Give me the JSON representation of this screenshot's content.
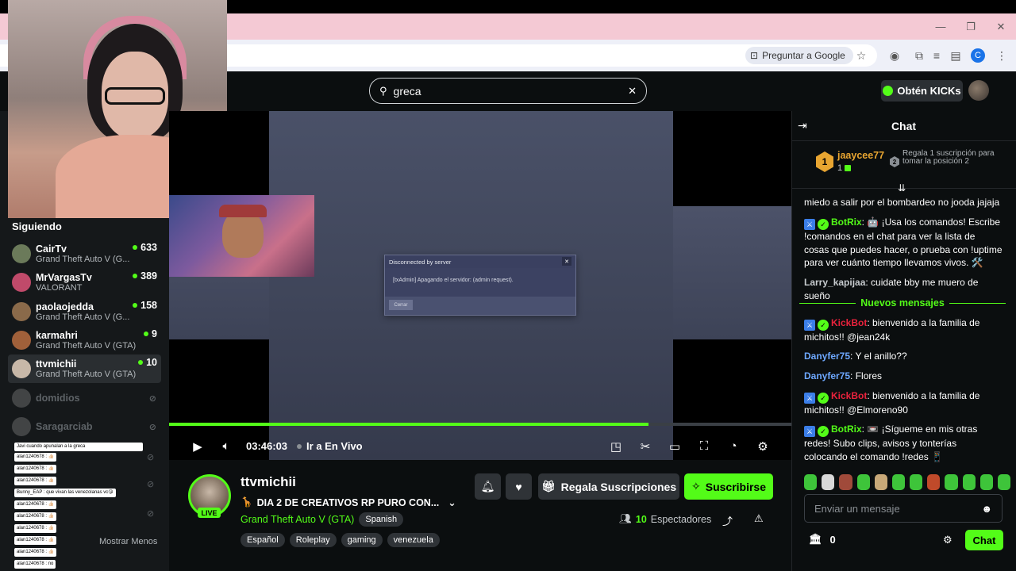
{
  "browser": {
    "google_button": "Preguntar a Google",
    "profile_initial": "C",
    "window_controls": [
      "—",
      "❐",
      "✕"
    ]
  },
  "header": {
    "search_value": "greca",
    "kicks_label": "Obtén KICKs"
  },
  "sidebar": {
    "following_title": "Siguiendo",
    "items": [
      {
        "name": "CairTv",
        "game": "Grand Theft Auto V (G...",
        "viewers": "633",
        "color": "#6b7a5a"
      },
      {
        "name": "MrVargasTv",
        "game": "VALORANT",
        "viewers": "389",
        "color": "#c04a6a"
      },
      {
        "name": "paolaojedda",
        "game": "Grand Theft Auto V (G...",
        "viewers": "158",
        "color": "#8a6a4a"
      },
      {
        "name": "karmahri",
        "game": "Grand Theft Auto V (GTA)",
        "viewers": "9",
        "color": "#a0603a"
      },
      {
        "name": "ttvmichii",
        "game": "Grand Theft Auto V (GTA)",
        "viewers": "10",
        "color": "#c8b8a8"
      }
    ],
    "offline": [
      {
        "name": "domidios"
      },
      {
        "name": "Saragarciab"
      }
    ],
    "show_less": "Mostrar Menos",
    "overlay_chat": [
      "Javi cuando apunalan a la greca",
      "alan1240678 : 👍🏻",
      "alan1240678 : 👍🏻",
      "alan1240678 : 👍🏻",
      "Bunny_EAP : que vivan las venezolanas vc😘",
      "alan1240678 : 👍🏻",
      "alan1240678 : 👍🏻",
      "alan1240678 : 👍🏻",
      "alan1240678 : 👍🏻",
      "alan1240678 : 👍🏻",
      "alan1240678 : no"
    ]
  },
  "video": {
    "dialog_title": "Disconnected by server",
    "dialog_message": "[txAdmin] Apagando el servidor: (admin request).",
    "dialog_button": "Cerrar",
    "time": "03:46:03",
    "go_live": "Ir a En Vivo",
    "progress": 0.77
  },
  "stream": {
    "name": "ttvmichii",
    "live_badge": "LIVE",
    "title": "DIA 2 DE CREATIVOS RP PURO CON...",
    "game": "Grand Theft Auto V (GTA)",
    "language_tag": "Spanish",
    "tags": [
      "Español",
      "Roleplay",
      "gaming",
      "venezuela"
    ],
    "gift_label": "Regala Suscripciones",
    "subscribe_label": "Suscribirse",
    "viewers_count": "10",
    "viewers_label": "Espectadores"
  },
  "chat": {
    "title": "Chat",
    "pinned_user": "jaaycee77",
    "pinned_count": "1",
    "pinned_rank": "1",
    "gift_rank": "2",
    "gift_text": "Regala 1 suscripción para tomar la posición 2",
    "messages_before": [
      {
        "user": "",
        "text": "miedo a salir por el bombardeo no jooda jajaja",
        "color": "#ffffff",
        "badges": false
      },
      {
        "user": "BotRix",
        "text": ": 🤖 ¡Usa los comandos! Escribe !comandos en el chat para ver la lista de cosas que puedes hacer, o prueba con !uptime para ver cuánto tiempo llevamos vivos. 🛠️",
        "color": "#53fc18",
        "badges": true
      },
      {
        "user": "Larry_kapijaa",
        "text": ": cuidate bby me muero de sueño",
        "color": "#c7cbce",
        "badges": false
      }
    ],
    "new_messages": "Nuevos mensajes",
    "messages_after": [
      {
        "user": "KickBot",
        "text": ": bienvenido a la familia de michitos!! @jean24k",
        "color": "#e8223c",
        "badges": true
      },
      {
        "user": "Danyfer75",
        "text": ": Y el anillo??",
        "color": "#6ea8ff",
        "badges": false
      },
      {
        "user": "Danyfer75",
        "text": ": Flores",
        "color": "#6ea8ff",
        "badges": false
      },
      {
        "user": "KickBot",
        "text": ": bienvenido a la familia de michitos!! @Elmoreno90",
        "color": "#e8223c",
        "badges": true
      },
      {
        "user": "BotRix",
        "text": ": 📼 ¡Sígueme en mis otras redes! Subo clips, avisos y tonterías colocando el comando !redes 📱",
        "color": "#53fc18",
        "badges": true
      }
    ],
    "input_placeholder": "Enviar un mensaje",
    "points": "0",
    "send_label": "Chat",
    "emote_colors": [
      "#3ec43a",
      "#d8d8d8",
      "#a04a3a",
      "#3ec43a",
      "#c8a878",
      "#3ec43a",
      "#3ec43a",
      "#c04a2a",
      "#3ec43a",
      "#3ec43a",
      "#3ec43a",
      "#3ec43a"
    ]
  }
}
